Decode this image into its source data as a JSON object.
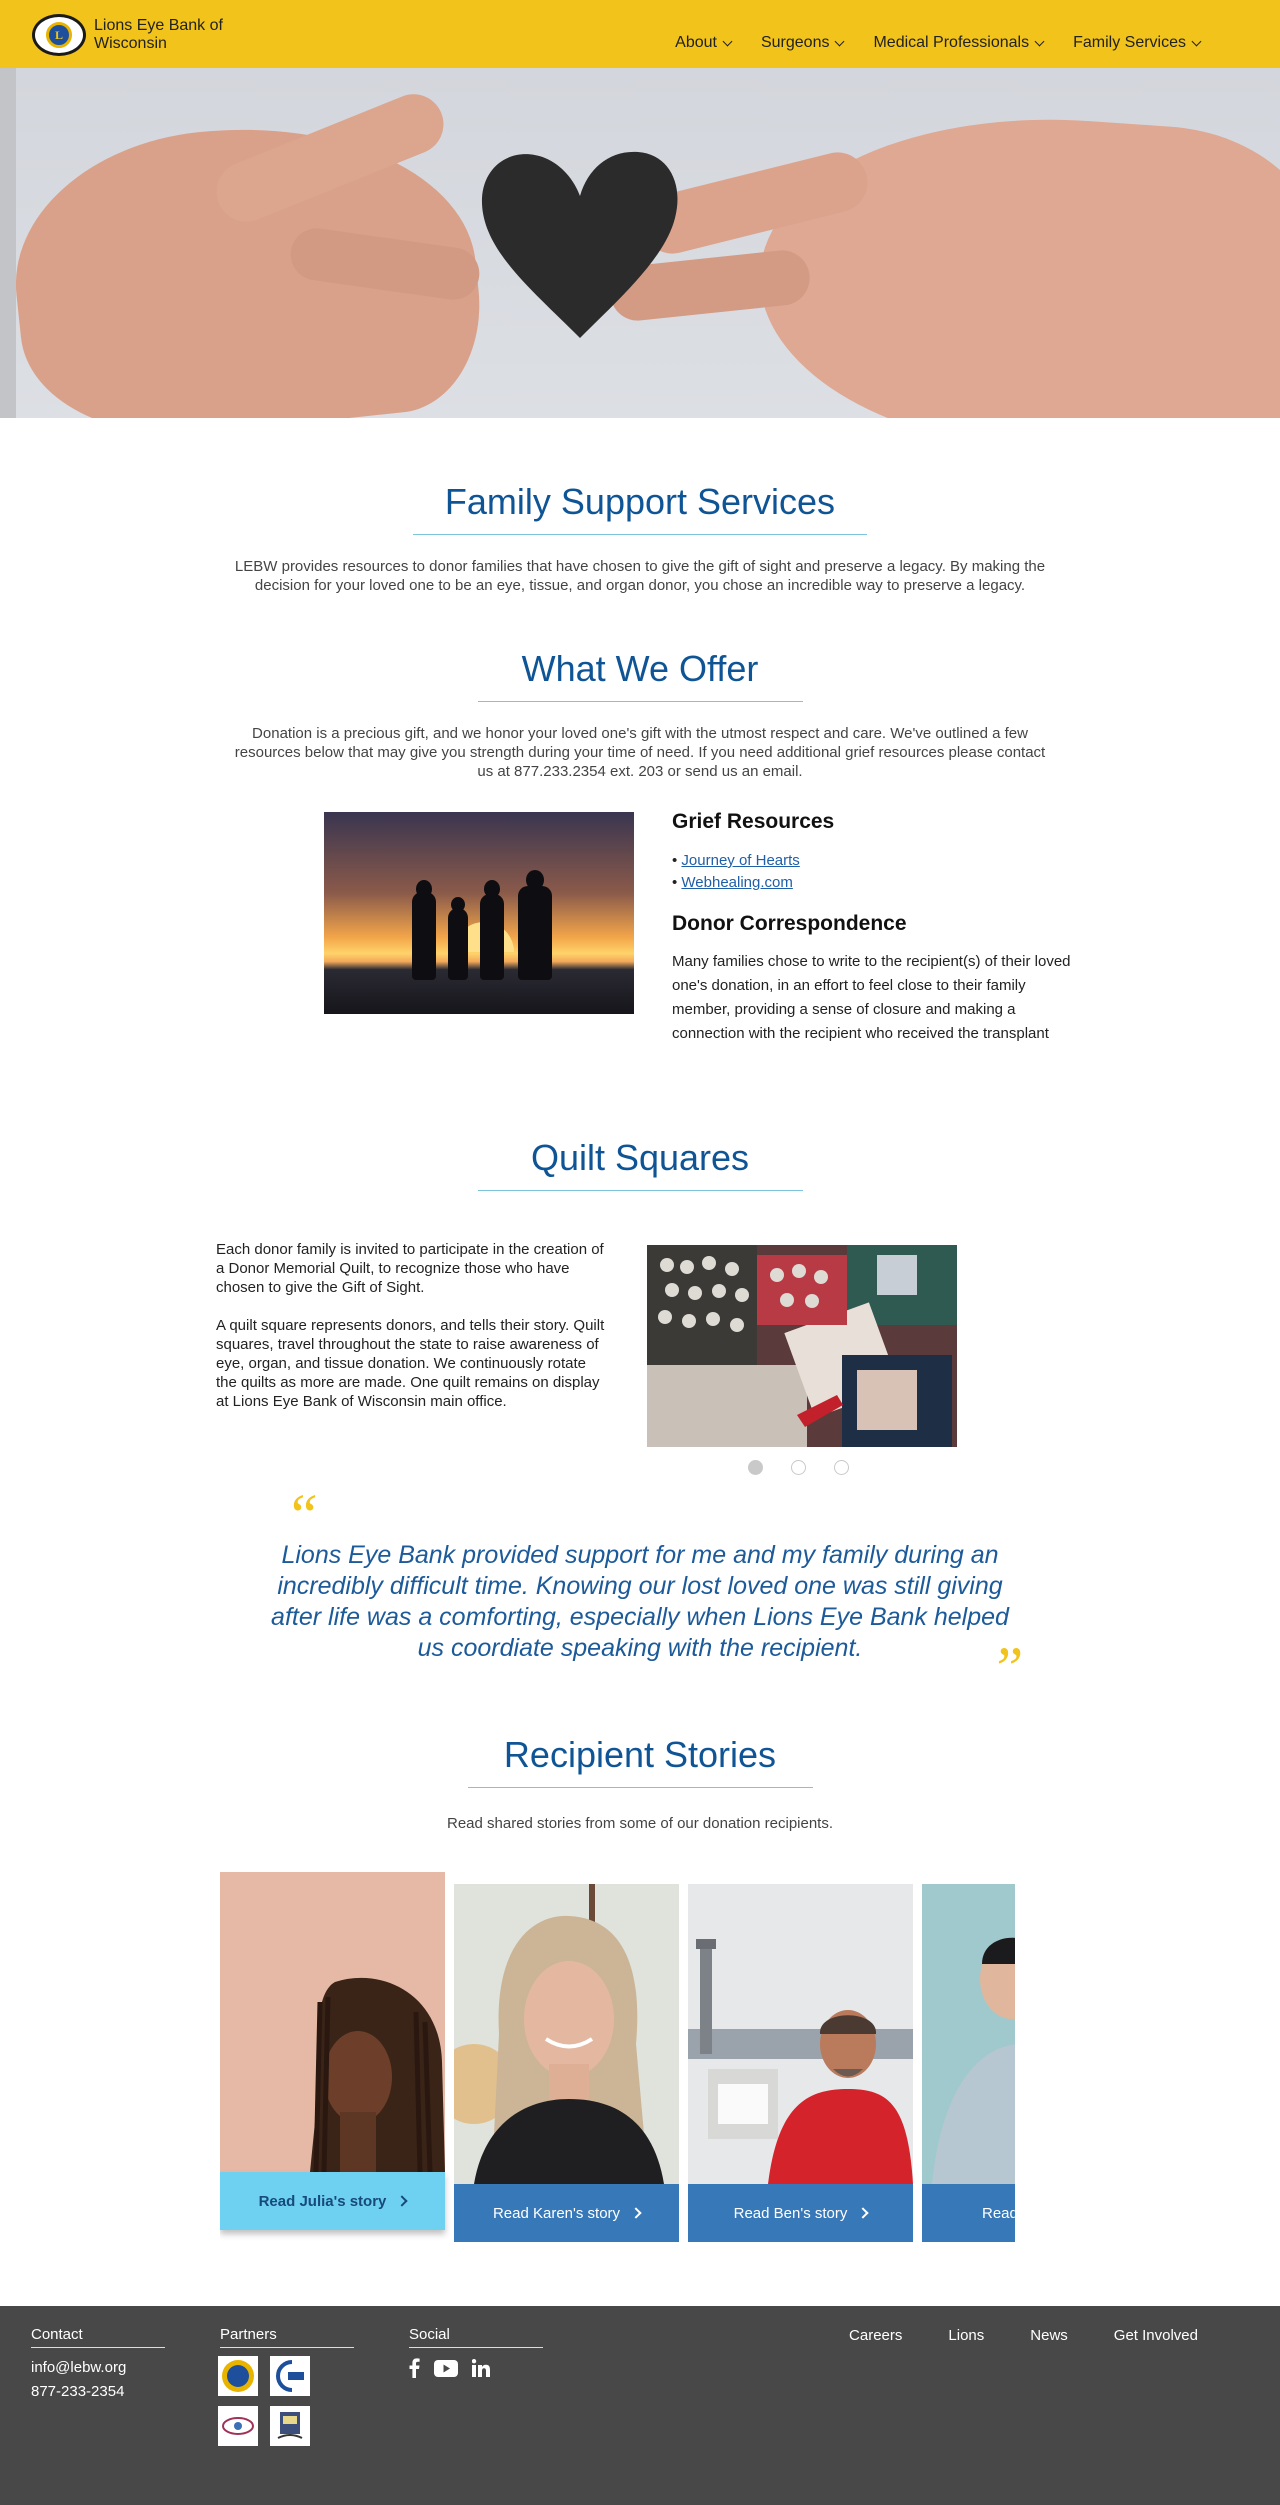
{
  "header": {
    "logo_text": "Lions Eye Bank of Wisconsin",
    "logo_mark": "L",
    "nav": [
      "About",
      "Surgeons",
      "Medical Professionals",
      "Family Services"
    ]
  },
  "family_support": {
    "title": "Family Support Services",
    "text": "LEBW provides resources to donor families that have chosen to give the gift of sight and preserve a legacy. By making the decision for your loved one to be an eye, tissue, and organ donor, you chose an incredible way to preserve a legacy."
  },
  "offer": {
    "title": "What We Offer",
    "text": "Donation is a precious gift, and we honor your loved one's gift with the utmost respect and care. We've outlined a few resources below that may give you strength during your time of need. If you need additional grief resources please contact us at 877.233.2354 ext. 203 or send us an email.",
    "grief_title": "Grief Resources",
    "grief_links": [
      "Journey of Hearts",
      "Webhealing.com"
    ],
    "correspondence_title": "Donor Correspondence",
    "correspondence_text": "Many families chose to write to the recipient(s) of their loved one's donation, in an effort to feel close to their family member, providing a sense of closure and making a connection with the recipient who received the transplant"
  },
  "quilt": {
    "title": "Quilt Squares",
    "p1": "Each donor family is invited to participate in the creation of a Donor Memorial Quilt, to recognize those who have chosen to give the Gift of Sight.",
    "p2": "A quilt square represents donors, and tells their story. Quilt squares, travel throughout the state to raise awareness of eye, organ, and tissue donation. We continuously rotate the quilts as more are made. One quilt remains on display at Lions Eye Bank of Wisconsin main office.",
    "slide_count": 3,
    "active_slide": 1
  },
  "quote": {
    "open": "“",
    "close": "”",
    "text": "Lions Eye Bank provided support for me and my family during an incredibly difficult time. Knowing our lost loved one was still giving after life was a comforting, especially when Lions Eye Bank helped us coordiate speaking with the recipient."
  },
  "stories": {
    "title": "Recipient Stories",
    "text": "Read shared stories from some of our donation recipients.",
    "cards": [
      {
        "label": "Read Julia's story"
      },
      {
        "label": "Read Karen's story"
      },
      {
        "label": "Read Ben's story"
      },
      {
        "label": "Read"
      }
    ]
  },
  "footer": {
    "contact_title": "Contact",
    "email": "info@lebw.org",
    "phone": "877-233-2354",
    "partners_title": "Partners",
    "social_title": "Social",
    "links": [
      "Careers",
      "Lions",
      "News",
      "Get Involved"
    ],
    "icons": [
      "facebook-icon",
      "youtube-icon",
      "linkedin-icon"
    ]
  },
  "colors": {
    "header_bg": "#f2c31b",
    "heading_blue": "#0f5596",
    "button_blue": "#3778b8",
    "button_light": "#6fd1f2",
    "footer_bg": "#484848"
  }
}
